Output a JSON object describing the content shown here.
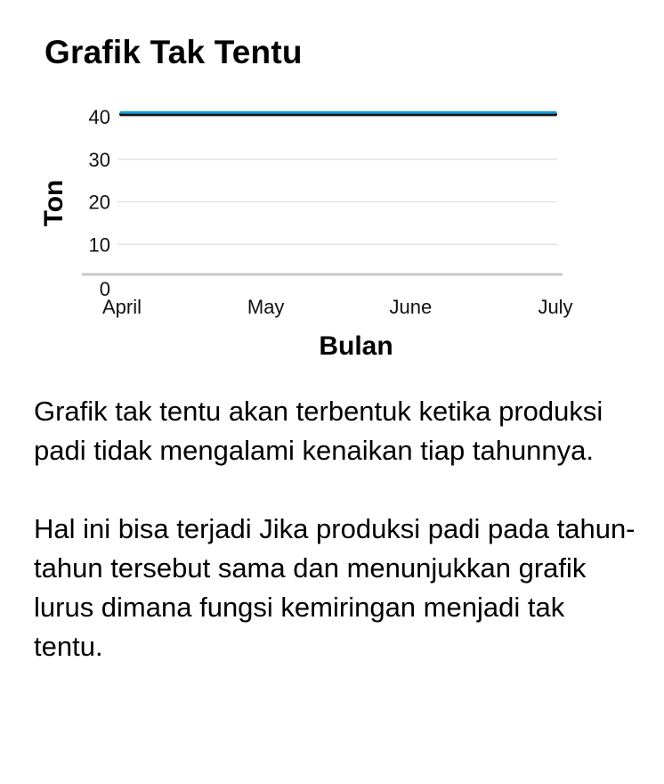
{
  "chart_data": {
    "type": "line",
    "title": "Grafik Tak Tentu",
    "xlabel": "Bulan",
    "ylabel": "Ton",
    "categories": [
      "April",
      "May",
      "June",
      "July"
    ],
    "series": [
      {
        "values": [
          41,
          41,
          41,
          41
        ],
        "color": "#1a9ad6"
      }
    ],
    "yticks": [
      0,
      10,
      20,
      30,
      40
    ],
    "ylim": [
      0,
      42
    ],
    "grid": true,
    "legend": "none"
  },
  "description": {
    "paragraphs": [
      "Grafik tak tentu akan terbentuk ketika produksi padi tidak mengalami kenaikan tiap tahunnya.",
      "Hal ini bisa terjadi Jika produksi padi pada tahun-tahun tersebut sama dan menunjukkan grafik lurus dimana fungsi kemiringan menjadi tak tentu."
    ]
  }
}
